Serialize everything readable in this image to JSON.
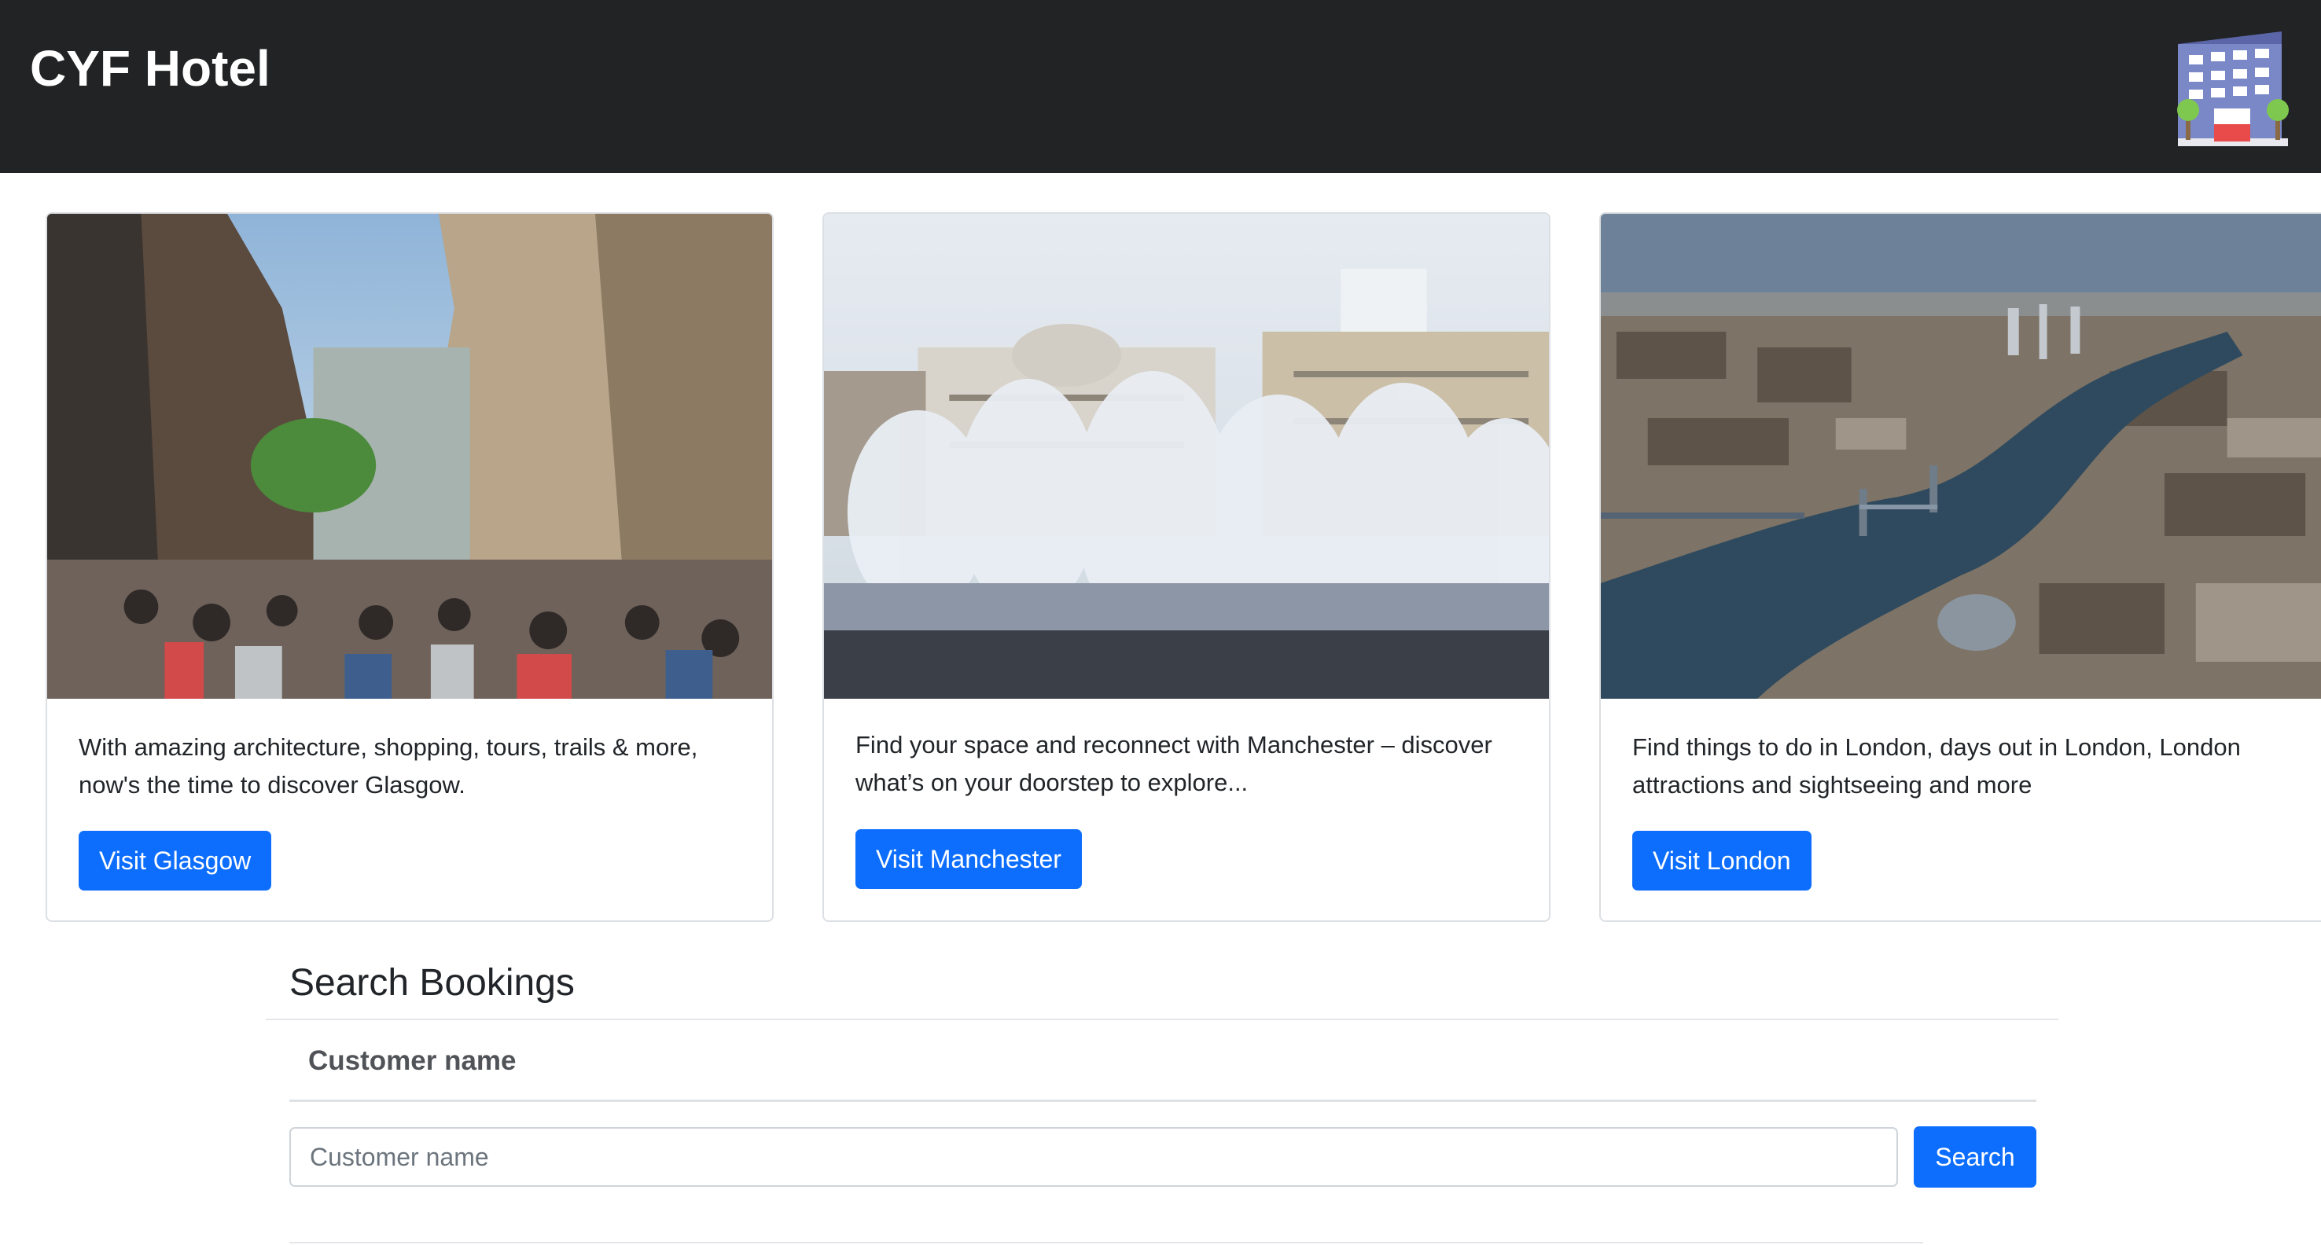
{
  "header": {
    "brand": "CYF Hotel",
    "logo_icon": "hotel-building-icon"
  },
  "cards": [
    {
      "image": "glasgow-street-photo",
      "text": "With amazing architecture, shopping, tours, trails & more, now's the time to discover Glasgow.",
      "button_label": "Visit Glasgow"
    },
    {
      "image": "manchester-fountain-photo",
      "text": "Find your space and reconnect with Manchester – discover what’s on your doorstep to explore...",
      "button_label": "Visit Manchester"
    },
    {
      "image": "london-aerial-photo",
      "text": "Find things to do in London, days out in London, London attractions and sightseeing and more",
      "button_label": "Visit London"
    }
  ],
  "search": {
    "title": "Search Bookings",
    "field_label": "Customer name",
    "input_value": "",
    "input_placeholder": "Customer name",
    "button_label": "Search"
  },
  "colors": {
    "header_bg": "#222324",
    "primary": "#0d6efd",
    "card_border": "#dcdfe3"
  }
}
